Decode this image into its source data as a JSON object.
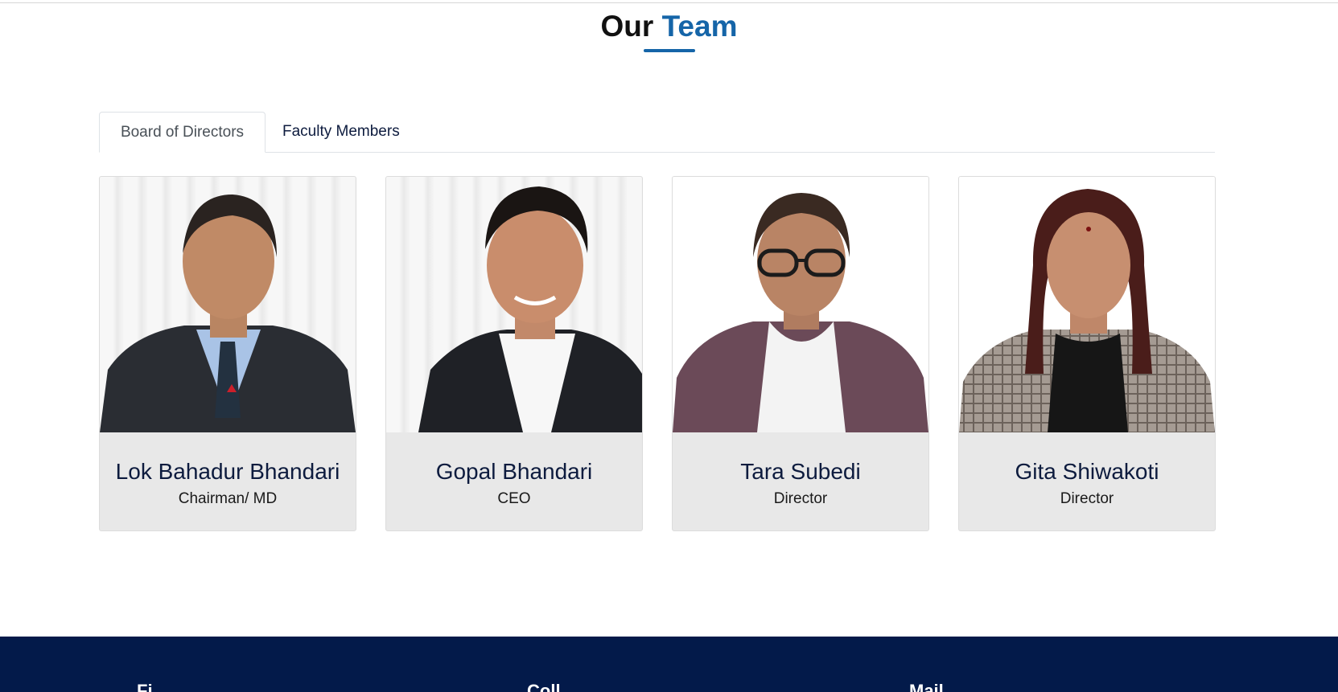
{
  "section": {
    "title_part1": "Our",
    "title_part2": "Team"
  },
  "tabs": [
    {
      "label": "Board of Directors",
      "active": true
    },
    {
      "label": "Faculty Members",
      "active": false
    }
  ],
  "members": [
    {
      "name": "Lok Bahadur Bhandari",
      "role": "Chairman/ MD"
    },
    {
      "name": "Gopal Bhandari",
      "role": "CEO"
    },
    {
      "name": "Tara Subedi",
      "role": "Director"
    },
    {
      "name": "Gita Shiwakoti",
      "role": "Director"
    }
  ],
  "footer": {
    "columns": [
      "Fi...",
      "Coll...",
      "Mail..."
    ]
  },
  "colors": {
    "accent": "#1565a8",
    "navy_text": "#0d1b3e",
    "footer_bg": "#031a4a",
    "card_bg": "#e8e8e8"
  }
}
